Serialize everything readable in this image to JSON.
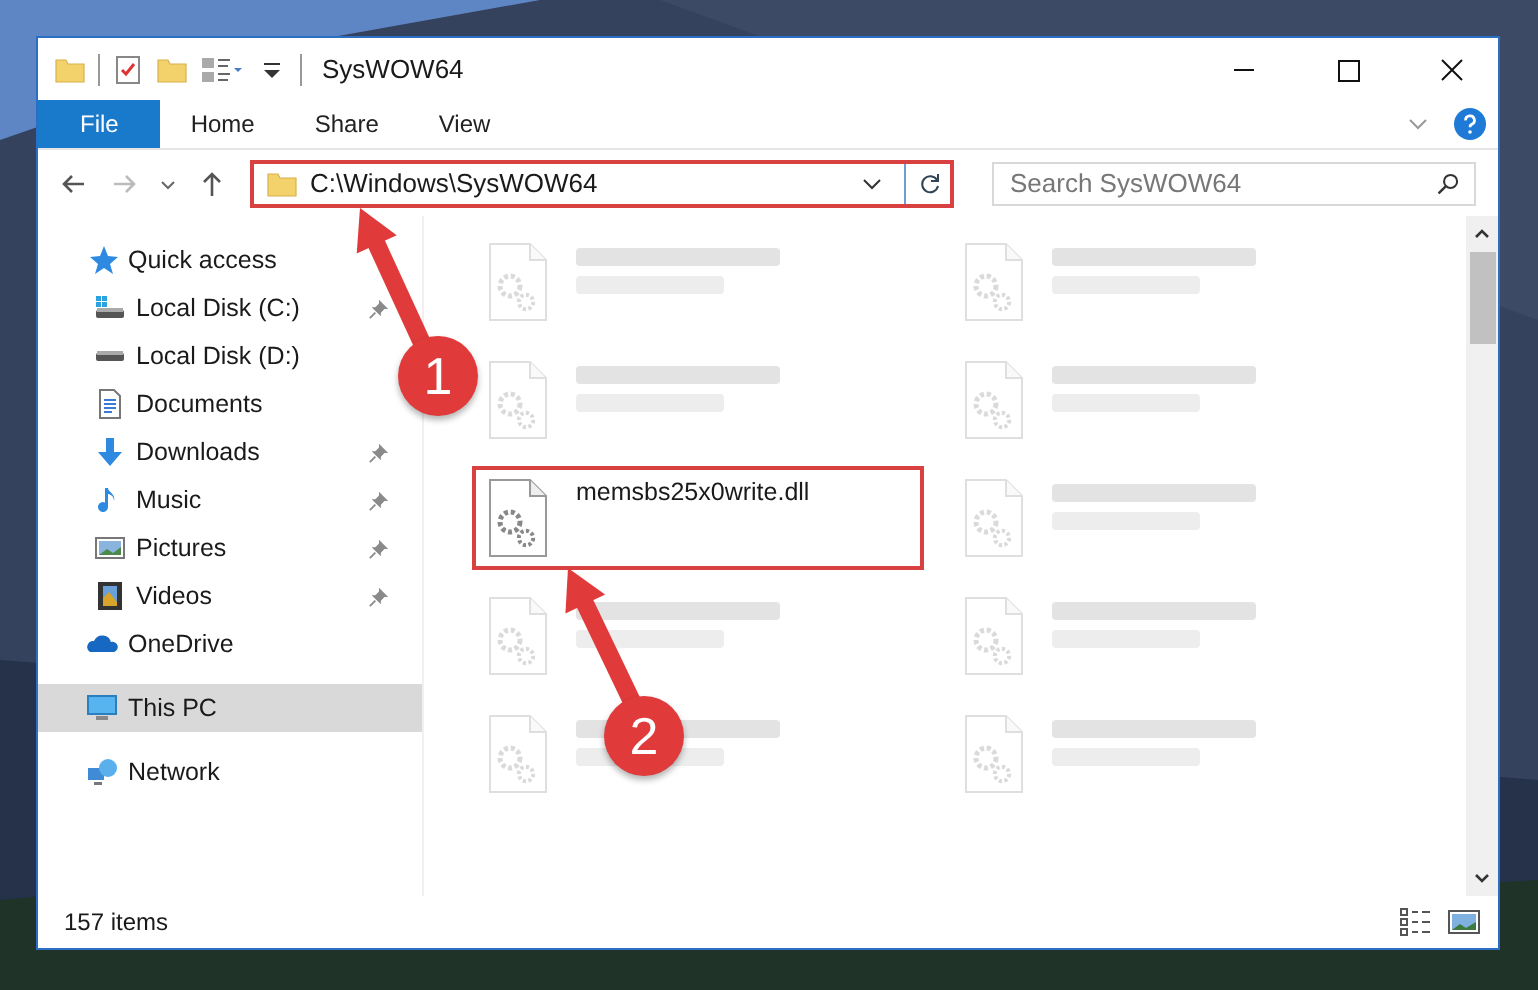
{
  "window": {
    "title": "SysWOW64"
  },
  "ribbon": {
    "tabs": [
      {
        "label": "File",
        "selected": true
      },
      {
        "label": "Home",
        "selected": false
      },
      {
        "label": "Share",
        "selected": false
      },
      {
        "label": "View",
        "selected": false
      }
    ]
  },
  "address_bar": {
    "path": "C:\\Windows\\SysWOW64",
    "highlighted": true
  },
  "search": {
    "placeholder": "Search SysWOW64"
  },
  "sidebar": {
    "items": [
      {
        "label": "Quick access",
        "kind": "star",
        "selected": false,
        "children": [
          {
            "label": "Local Disk (C:)",
            "kind": "system-drive",
            "pinned": true,
            "selected": false
          },
          {
            "label": "Local Disk (D:)",
            "kind": "drive",
            "pinned": false,
            "selected": false
          },
          {
            "label": "Documents",
            "kind": "document",
            "pinned": false,
            "selected": false
          },
          {
            "label": "Downloads",
            "kind": "download",
            "pinned": true,
            "selected": false
          },
          {
            "label": "Music",
            "kind": "music",
            "pinned": true,
            "selected": false
          },
          {
            "label": "Pictures",
            "kind": "picture",
            "pinned": true,
            "selected": false
          },
          {
            "label": "Videos",
            "kind": "video",
            "pinned": true,
            "selected": false
          }
        ]
      },
      {
        "label": "OneDrive",
        "kind": "cloud",
        "selected": false
      },
      {
        "label": "This PC",
        "kind": "computer",
        "selected": true
      },
      {
        "label": "Network",
        "kind": "network",
        "selected": false
      }
    ]
  },
  "files": [
    {
      "faded": true,
      "highlighted": false
    },
    {
      "faded": true,
      "highlighted": false
    },
    {
      "faded": true,
      "highlighted": false
    },
    {
      "faded": true,
      "highlighted": false
    },
    {
      "name": "memsbs25x0write.dll",
      "faded": false,
      "highlighted": true
    },
    {
      "faded": true,
      "highlighted": false
    },
    {
      "faded": true,
      "highlighted": false
    },
    {
      "faded": true,
      "highlighted": false
    },
    {
      "faded": true,
      "highlighted": false
    },
    {
      "faded": true,
      "highlighted": false
    }
  ],
  "annotations": [
    {
      "label": "1"
    },
    {
      "label": "2"
    }
  ],
  "status_bar": {
    "item_count": "157 items"
  }
}
